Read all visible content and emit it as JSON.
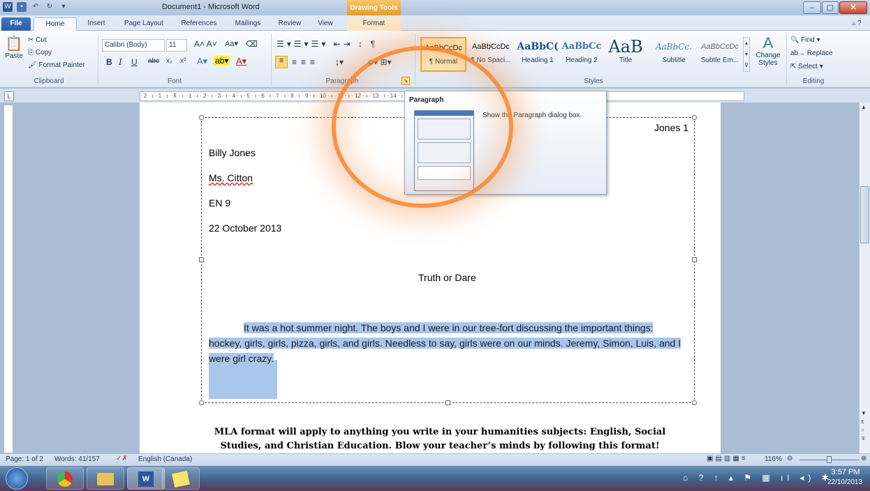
{
  "title_bar": {
    "document_title": "Document1 - Microsoft Word",
    "contextual_tab_group": "Drawing Tools",
    "minimize": "–",
    "maximize": "▢",
    "close": "✕"
  },
  "tabs": [
    "File",
    "Home",
    "Insert",
    "Page Layout",
    "References",
    "Mailings",
    "Review",
    "View",
    "Format"
  ],
  "ribbon": {
    "clipboard": {
      "paste": "Paste",
      "cut": "Cut",
      "copy": "Copy",
      "format_painter": "Format Painter",
      "label": "Clipboard"
    },
    "font": {
      "font_name": "Calibri (Body)",
      "font_size": "11",
      "label": "Font",
      "bold": "B",
      "italic": "I",
      "underline": "U",
      "strike": "abc",
      "subscript": "x₂",
      "superscript": "x²"
    },
    "paragraph": {
      "label": "Paragraph"
    },
    "styles": {
      "label": "Styles",
      "items": [
        {
          "sample": "AaBbCcDc",
          "name": "¶ Normal"
        },
        {
          "sample": "AaBbCcDc",
          "name": "¶ No Spaci..."
        },
        {
          "sample": "AaBbC(",
          "name": "Heading 1"
        },
        {
          "sample": "AaBbCc",
          "name": "Heading 2"
        },
        {
          "sample": "AaB",
          "name": "Title"
        },
        {
          "sample": "AaBbCc.",
          "name": "Subtitle"
        },
        {
          "sample": "AaBbCcDc",
          "name": "Subtle Em..."
        }
      ],
      "change_styles": "Change Styles"
    },
    "editing": {
      "find": "Find",
      "replace": "Replace",
      "select": "Select",
      "label": "Editing"
    }
  },
  "ruler_text": "· 2 · ı · 1 · ı · ⊼ · ı · 1 · ı · 2 · ı · 3 · ı · 4 · ı · 5 · ı · 6 · ı · 7 · ı · 8 · ı · 9 · ı · 10 · ı · 11 · ı · 12 · ı · 13 · ı · 14 · ı · 15 · ı · 16 · ı · 17 · ı · 18 · ı · 19",
  "tooltip": {
    "title": "Paragraph",
    "description": "Show the Paragraph dialog box."
  },
  "document": {
    "header": "Jones 1",
    "name": "Billy Jones",
    "teacher": "Ms. Citton",
    "course": "EN 9",
    "date": "22 October 2013",
    "essay_title": "Truth or Dare",
    "paragraph_lines": [
      "It was a hot summer night. The boys and I were in our tree-fort discussing the important things:",
      "hockey, girls, girls, pizza, girls, and girls. Needless to say, girls were on our minds. Jeremy, Simon, Luis, and I",
      "were girl crazy."
    ],
    "mla_note": "MLA format will apply to anything you write in your humanities subjects: English, Social Studies, and Christian Education. Blow your teacher’s minds by following this format!"
  },
  "status_bar": {
    "page": "Page: 1 of 2",
    "words": "Words: 41/157",
    "language": "English (Canada)",
    "zoom": "116%"
  },
  "taskbar": {
    "time": "3:57 PM",
    "date": "22/10/2013"
  },
  "colors": {
    "accent": "#2a5da8",
    "highlight_ring": "#f68831",
    "selection": "#a9c7ec"
  }
}
